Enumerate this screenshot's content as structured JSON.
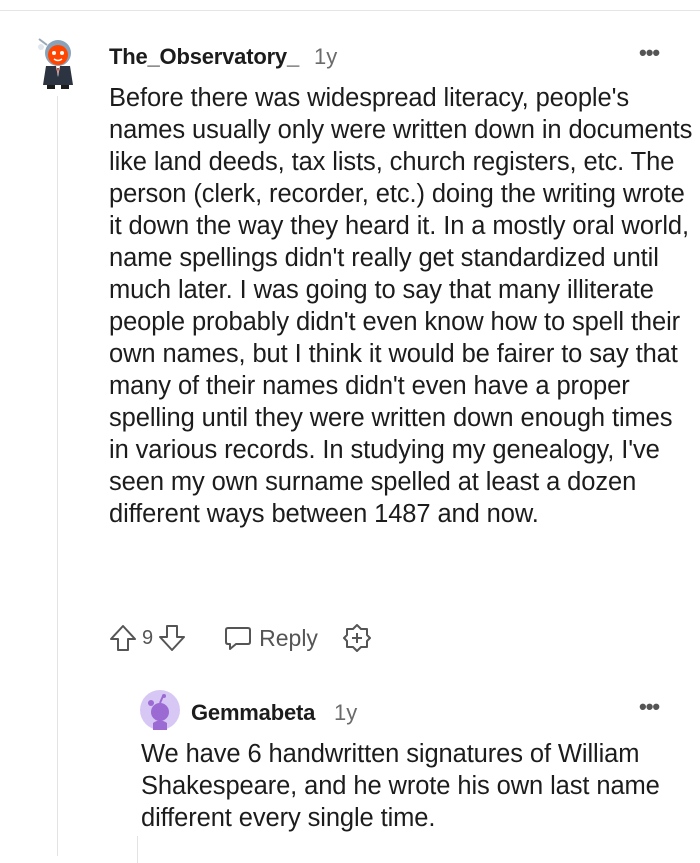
{
  "comment": {
    "author": "The_Observatory_",
    "age": "1y",
    "more_label": "•••",
    "body": "Before there was widespread literacy, people's names usually only were written down in documents like land deeds, tax lists, church registers, etc. The person (clerk, recorder, etc.) doing the writing wrote it down the way they heard it. In a mostly oral world, name spellings didn't really get standardized until much later. I was going to say that many illiterate people probably didn't even know how to spell their own names, but I think it would be fairer to say that many of their names didn't even have a proper spelling until they were written down enough times in various records. In studying my genealogy, I've seen my own surname spelled at least a dozen different ways between 1487 and now.",
    "score": "9",
    "reply_label": "Reply",
    "icons": {
      "avatar": "snoo-avatar-icon",
      "upvote": "upvote-arrow-icon",
      "downvote": "downvote-arrow-icon",
      "reply": "speech-bubble-icon",
      "award": "award-plus-icon"
    }
  },
  "reply": {
    "author": "Gemmabeta",
    "age": "1y",
    "more_label": "•••",
    "body": "We have 6 handwritten signatures of William Shakespeare, and he wrote his own last name different every single time.",
    "icons": {
      "avatar": "snoo-avatar-icon"
    }
  },
  "colors": {
    "text": "#1c1c1c",
    "meta": "#6b6b6b",
    "avatar2_bg": "#d7c7f5",
    "avatar2_fg": "#9b6ad3",
    "avatar1_accent": "#ff4500"
  }
}
